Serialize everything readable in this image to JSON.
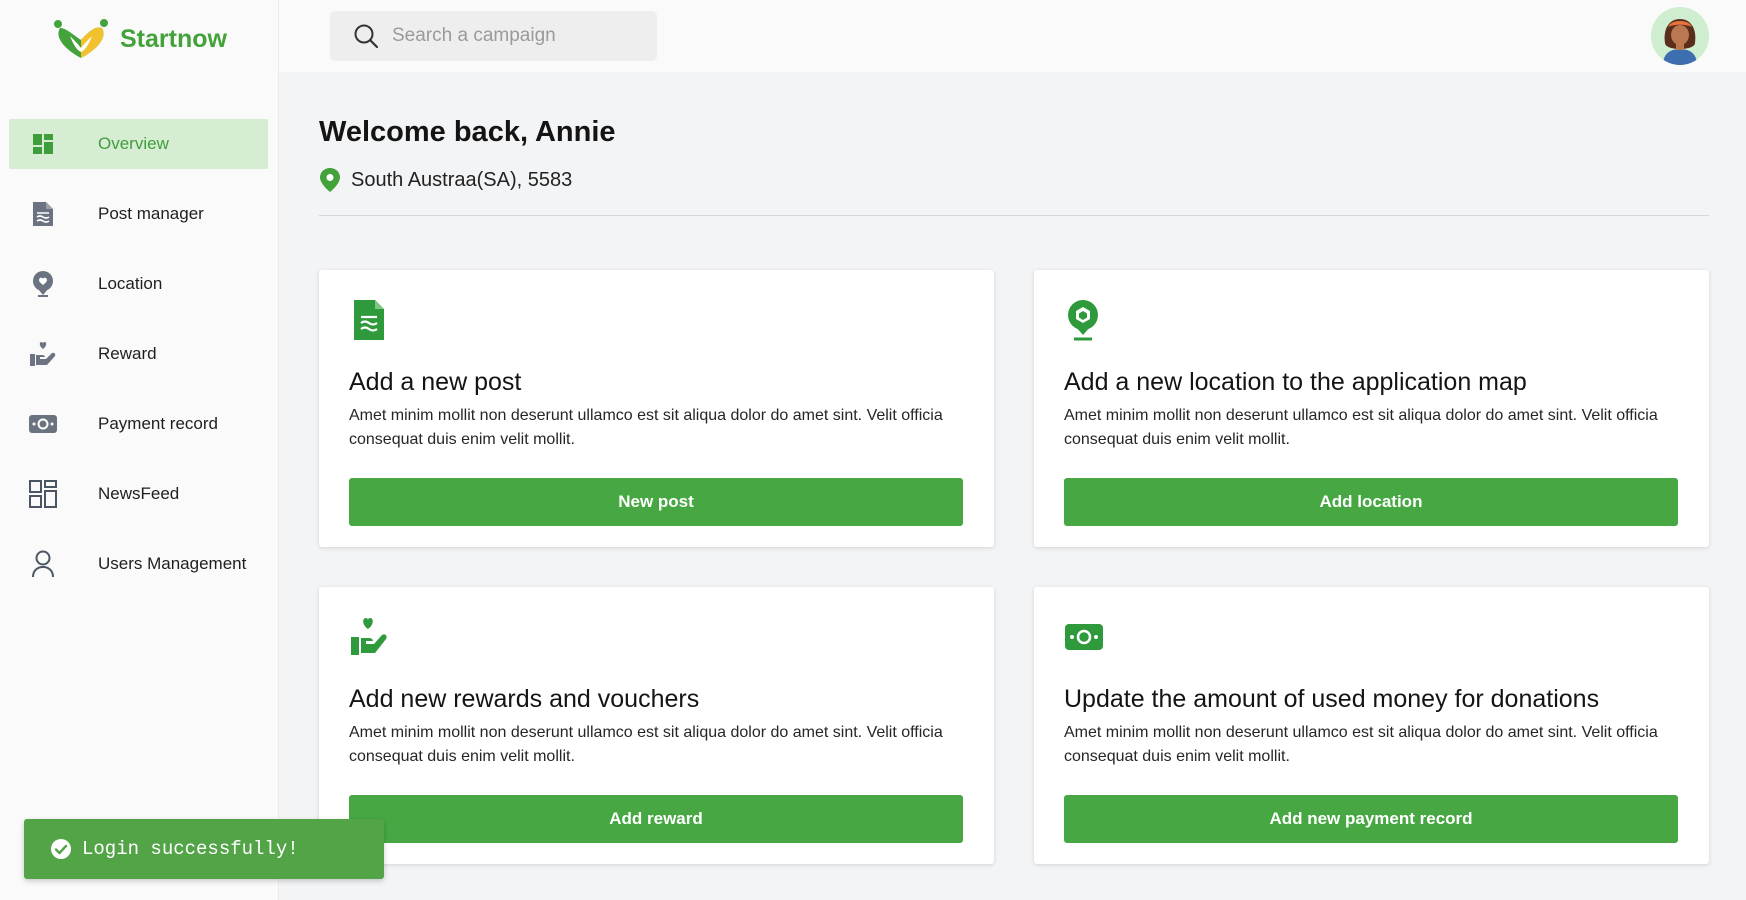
{
  "app": {
    "name": "Startnow",
    "brand_color": "#43a33a",
    "button_color": "#47a843"
  },
  "search": {
    "placeholder": "Search a campaign"
  },
  "sidebar": {
    "items": [
      {
        "label": "Overview",
        "icon": "dashboard-icon",
        "active": true
      },
      {
        "label": "Post manager",
        "icon": "document-icon"
      },
      {
        "label": "Location",
        "icon": "location-pin-icon"
      },
      {
        "label": "Reward",
        "icon": "hand-heart-icon"
      },
      {
        "label": "Payment record",
        "icon": "money-icon"
      },
      {
        "label": "NewsFeed",
        "icon": "newsfeed-icon"
      },
      {
        "label": "Users Management",
        "icon": "user-icon"
      }
    ]
  },
  "main": {
    "welcome": "Welcome back, Annie",
    "location": "South Austraa(SA), 5583"
  },
  "cards": [
    {
      "title": "Add a new post",
      "description": "Amet minim mollit non deserunt ullamco est sit aliqua dolor do amet sint. Velit officia consequat duis enim velit mollit.",
      "button": "New post",
      "icon": "document-icon"
    },
    {
      "title": "Add a new location to the application map",
      "description": "Amet minim mollit non deserunt ullamco est sit aliqua dolor do amet sint. Velit officia consequat duis enim velit mollit.",
      "button": "Add location",
      "icon": "location-pin-icon"
    },
    {
      "title": "Add new rewards and vouchers",
      "description": "Amet minim mollit non deserunt ullamco est sit aliqua dolor do amet sint. Velit officia consequat duis enim velit mollit.",
      "button": "Add reward",
      "icon": "hand-heart-icon"
    },
    {
      "title": "Update the amount of used money for donations",
      "description": "Amet minim mollit non deserunt ullamco est sit aliqua dolor do amet sint. Velit officia consequat duis enim velit mollit.",
      "button": "Add new payment record",
      "icon": "money-icon"
    }
  ],
  "toast": {
    "message": "Login successfully!"
  }
}
